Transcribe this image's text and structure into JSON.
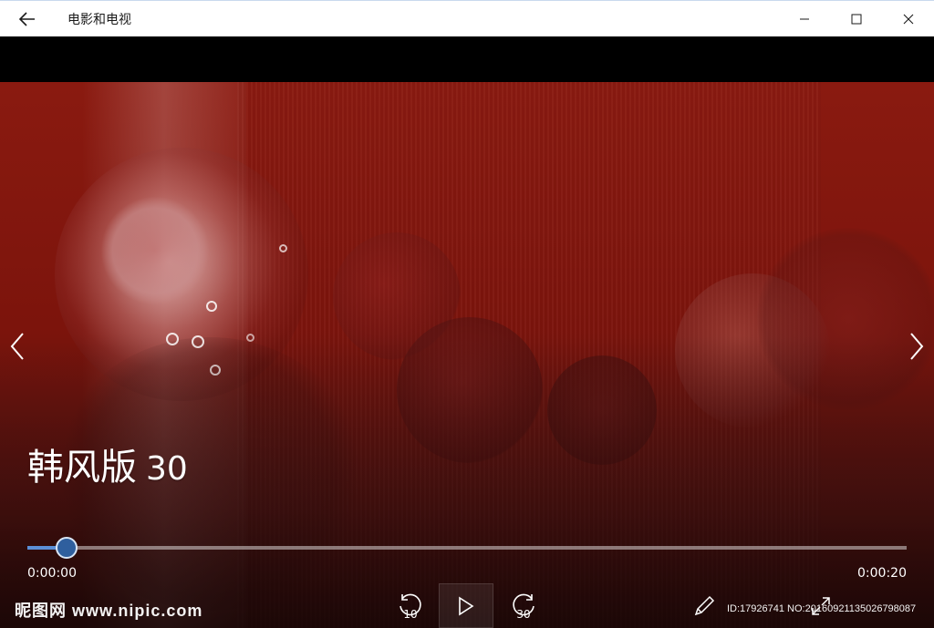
{
  "window": {
    "title": "电影和电视",
    "back_icon": "back-arrow-icon",
    "controls": [
      "minimize-icon",
      "maximize-icon",
      "close-icon"
    ]
  },
  "media": {
    "title_main": "韩风版",
    "title_num": "30"
  },
  "playback": {
    "current_time": "0:00:00",
    "total_time": "0:00:20",
    "progress_fraction": 0.045,
    "skip_back_label": "10",
    "skip_forward_label": "30",
    "accent_color": "#5b8fd6"
  },
  "watermark": {
    "site": "昵图网 www.nipic.com",
    "id_text": "ID:17926741 NO:20160921135026798087"
  }
}
